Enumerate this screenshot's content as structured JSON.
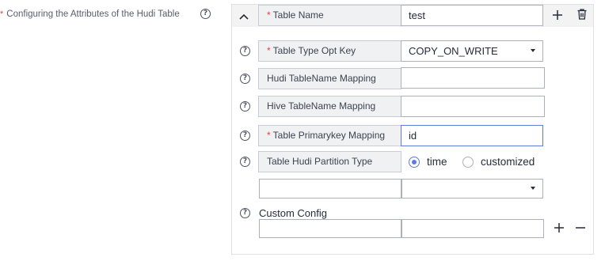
{
  "section": {
    "required_mark": "*",
    "label": "Configuring the Attributes of the Hudi Table",
    "help_icon": "question-circle-icon"
  },
  "table_entry": {
    "collapse_icon": "chevron-up-icon",
    "name_label": "Table Name",
    "name_required_mark": "*",
    "name_value": "test",
    "add_icon": "plus-icon",
    "delete_icon": "trash-icon"
  },
  "fields": {
    "table_type": {
      "required_mark": "*",
      "label": "Table Type Opt Key",
      "value": "COPY_ON_WRITE",
      "help_icon": "question-circle-icon",
      "arrow_icon": "caret-down-icon"
    },
    "hudi_tablename": {
      "label": "Hudi TableName Mapping",
      "value": "",
      "help_icon": "question-circle-icon"
    },
    "hive_tablename": {
      "label": "Hive TableName Mapping",
      "value": "",
      "help_icon": "question-circle-icon"
    },
    "primarykey": {
      "required_mark": "*",
      "label": "Table Primarykey Mapping",
      "value": "id",
      "help_icon": "question-circle-icon"
    },
    "partition_type": {
      "label": "Table Hudi Partition Type",
      "help_icon": "question-circle-icon",
      "options": [
        {
          "label": "time",
          "selected": true
        },
        {
          "label": "customized",
          "selected": false
        }
      ]
    },
    "partition_detail": {
      "input_value": "",
      "select_value": "",
      "arrow_icon": "caret-down-icon"
    },
    "custom_config": {
      "label": "Custom Config",
      "help_icon": "question-circle-icon",
      "key_value": "",
      "val_value": "",
      "add_icon": "plus-icon",
      "remove_icon": "minus-icon"
    }
  }
}
